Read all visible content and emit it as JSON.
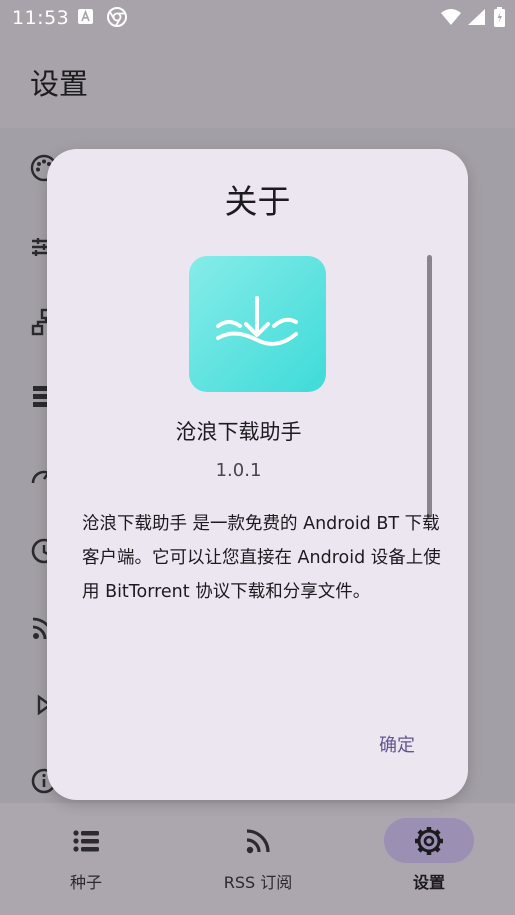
{
  "status_bar": {
    "time": "11:53"
  },
  "header": {
    "title": "设置"
  },
  "settings_list": {
    "icons": [
      "palette-icon",
      "tune-icon",
      "network-icon",
      "storage-icon",
      "speed-icon",
      "schedule-icon",
      "rss-icon",
      "play-icon",
      "info-icon"
    ]
  },
  "dialog": {
    "title": "关于",
    "app_name": "沧浪下载助手",
    "version": "1.0.1",
    "description": "沧浪下载助手 是一款免费的 Android BT 下载客户端。它可以让您直接在 Android 设备上使用 BitTorrent 协议下载和分享文件。",
    "ok_label": "确定"
  },
  "bottom_nav": {
    "items": [
      {
        "label": "种子",
        "icon": "list-icon"
      },
      {
        "label": "RSS 订阅",
        "icon": "rss-icon"
      },
      {
        "label": "设置",
        "icon": "gear-icon",
        "active": true
      }
    ]
  },
  "colors": {
    "accent": "#65558f",
    "app_icon": "#5ce3e0",
    "nav_pill": "#9c8fb4"
  }
}
